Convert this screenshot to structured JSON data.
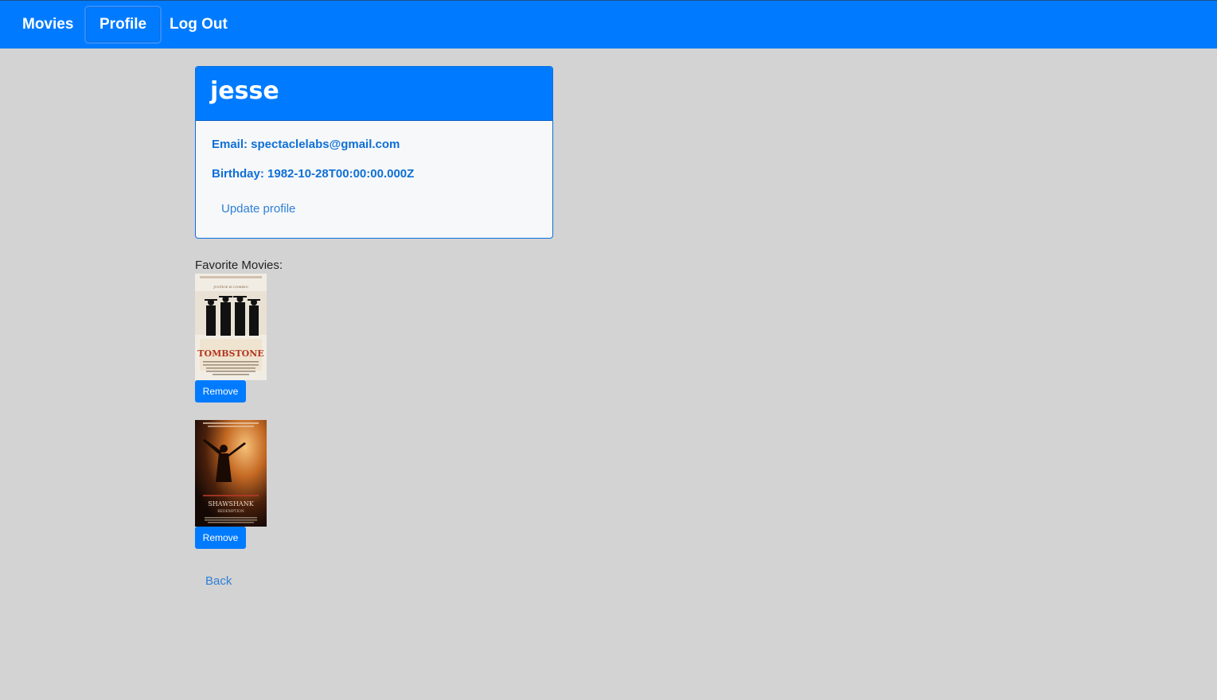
{
  "nav": {
    "movies_label": "Movies",
    "profile_label": "Profile",
    "logout_label": "Log Out"
  },
  "profile": {
    "username": "jesse",
    "email_line": "Email: spectaclelabs@gmail.com",
    "birthday_line": "Birthday: 1982-10-28T00:00:00.000Z",
    "update_label": "Update profile"
  },
  "favorites": {
    "label": "Favorite Movies:",
    "movies": [
      {
        "poster_alt": "Tombstone poster",
        "poster_title": "TOMBSTONE",
        "poster_tagline": "JUSTICE IS COMING",
        "remove_label": "Remove"
      },
      {
        "poster_alt": "The Shawshank Redemption poster",
        "poster_title": "SHAWSHANK",
        "poster_subtitle": "REDEMPTION",
        "remove_label": "Remove"
      }
    ]
  },
  "back_label": "Back",
  "colors": {
    "primary": "#007bff",
    "page_bg": "#d3d3d3",
    "card_bg": "#f6f8fa",
    "link": "#2f80d6"
  }
}
